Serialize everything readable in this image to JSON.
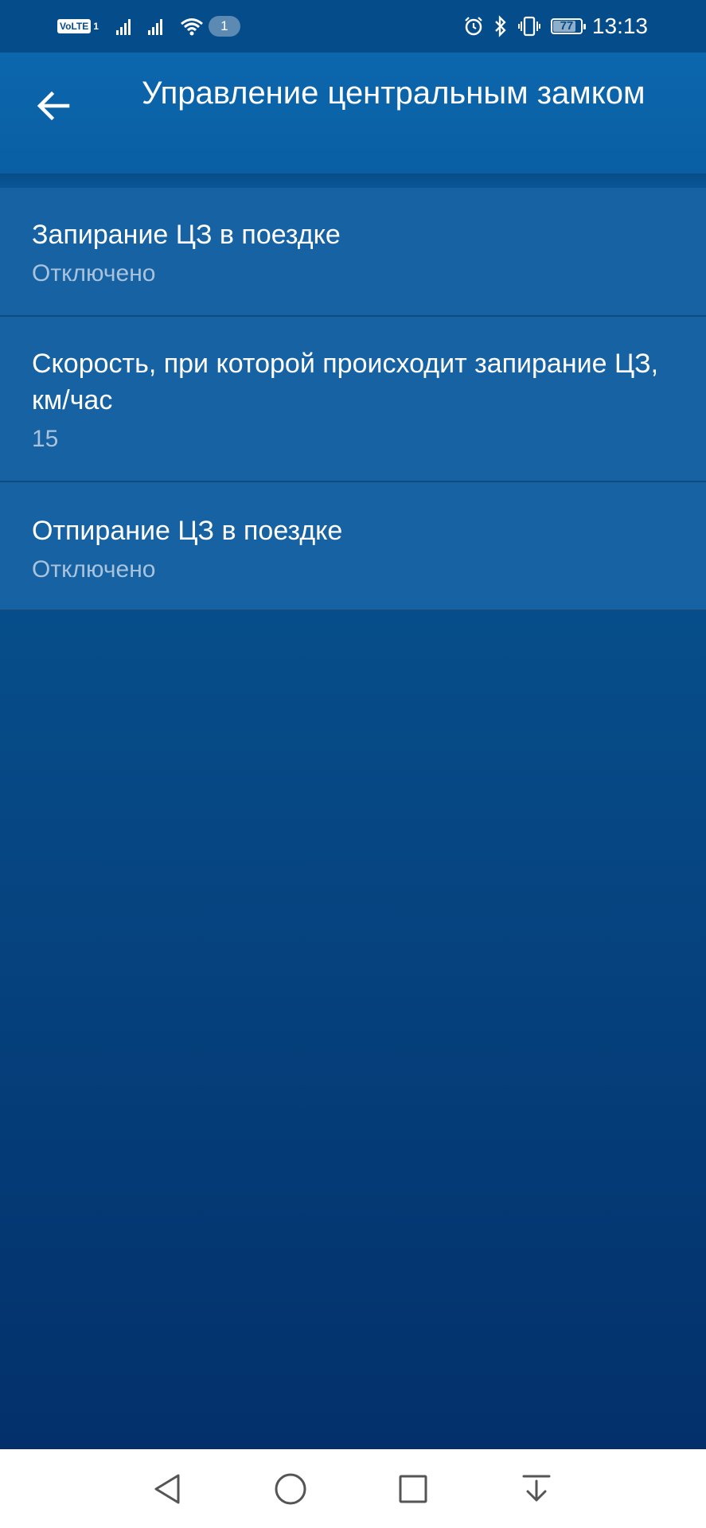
{
  "status_bar": {
    "volte_label": "VoLTE",
    "sim_index": "1",
    "wifi_badge": "1",
    "battery_level": "77",
    "time": "13:13"
  },
  "app_bar": {
    "title": "Управление центральным замком",
    "back_icon": "arrow-left-icon"
  },
  "settings": [
    {
      "title": "Запирание ЦЗ в поездке",
      "value": "Отключено"
    },
    {
      "title": "Скорость, при которой происходит запирание ЦЗ, км/час",
      "value": "15"
    },
    {
      "title": "Отпирание ЦЗ в поездке",
      "value": "Отключено"
    }
  ],
  "nav_bar": {
    "icons": [
      "back-triangle-icon",
      "home-circle-icon",
      "recents-square-icon",
      "notifications-pulldown-icon"
    ]
  },
  "colors": {
    "status_bar": "#054c8a",
    "app_bar": "#0c67ad",
    "list_item": "#1762a2",
    "subtitle": "#a9c3dd"
  }
}
